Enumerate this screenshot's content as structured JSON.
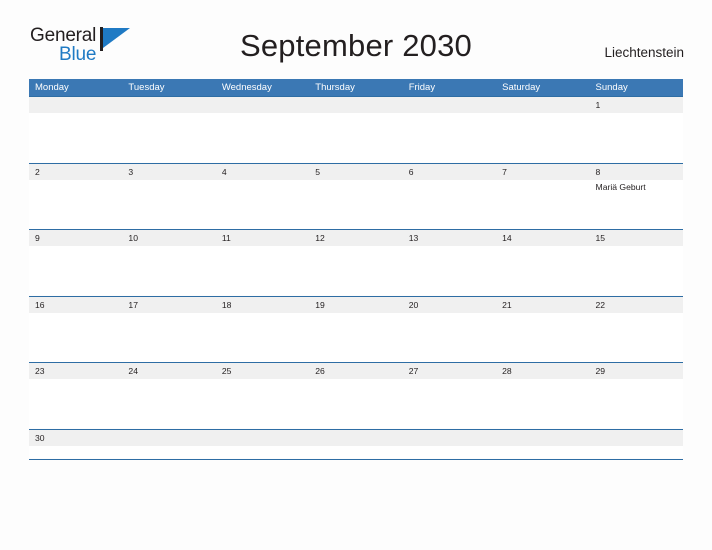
{
  "brand": {
    "name_part1": "General",
    "name_part2": "Blue",
    "flag_icon": "flag-triangle-icon"
  },
  "header": {
    "title": "September 2030",
    "country": "Liechtenstein"
  },
  "colors": {
    "header_blue": "#3b78b4",
    "rule_blue": "#2e6da4",
    "date_strip_gray": "#f0f0f0",
    "logo_blue": "#1f7ac4",
    "text_dark": "#231f20",
    "page_background": "#fdfdfd"
  },
  "calendar": {
    "weekdays": [
      "Monday",
      "Tuesday",
      "Wednesday",
      "Thursday",
      "Friday",
      "Saturday",
      "Sunday"
    ],
    "weeks": [
      {
        "days": [
          {
            "date": "",
            "events": []
          },
          {
            "date": "",
            "events": []
          },
          {
            "date": "",
            "events": []
          },
          {
            "date": "",
            "events": []
          },
          {
            "date": "",
            "events": []
          },
          {
            "date": "",
            "events": []
          },
          {
            "date": "1",
            "events": []
          }
        ]
      },
      {
        "days": [
          {
            "date": "2",
            "events": []
          },
          {
            "date": "3",
            "events": []
          },
          {
            "date": "4",
            "events": []
          },
          {
            "date": "5",
            "events": []
          },
          {
            "date": "6",
            "events": []
          },
          {
            "date": "7",
            "events": []
          },
          {
            "date": "8",
            "events": [
              "Mariä Geburt"
            ]
          }
        ]
      },
      {
        "days": [
          {
            "date": "9",
            "events": []
          },
          {
            "date": "10",
            "events": []
          },
          {
            "date": "11",
            "events": []
          },
          {
            "date": "12",
            "events": []
          },
          {
            "date": "13",
            "events": []
          },
          {
            "date": "14",
            "events": []
          },
          {
            "date": "15",
            "events": []
          }
        ]
      },
      {
        "days": [
          {
            "date": "16",
            "events": []
          },
          {
            "date": "17",
            "events": []
          },
          {
            "date": "18",
            "events": []
          },
          {
            "date": "19",
            "events": []
          },
          {
            "date": "20",
            "events": []
          },
          {
            "date": "21",
            "events": []
          },
          {
            "date": "22",
            "events": []
          }
        ]
      },
      {
        "days": [
          {
            "date": "23",
            "events": []
          },
          {
            "date": "24",
            "events": []
          },
          {
            "date": "25",
            "events": []
          },
          {
            "date": "26",
            "events": []
          },
          {
            "date": "27",
            "events": []
          },
          {
            "date": "28",
            "events": []
          },
          {
            "date": "29",
            "events": []
          }
        ]
      },
      {
        "days": [
          {
            "date": "30",
            "events": []
          },
          {
            "date": "",
            "events": []
          },
          {
            "date": "",
            "events": []
          },
          {
            "date": "",
            "events": []
          },
          {
            "date": "",
            "events": []
          },
          {
            "date": "",
            "events": []
          },
          {
            "date": "",
            "events": []
          }
        ]
      }
    ]
  }
}
